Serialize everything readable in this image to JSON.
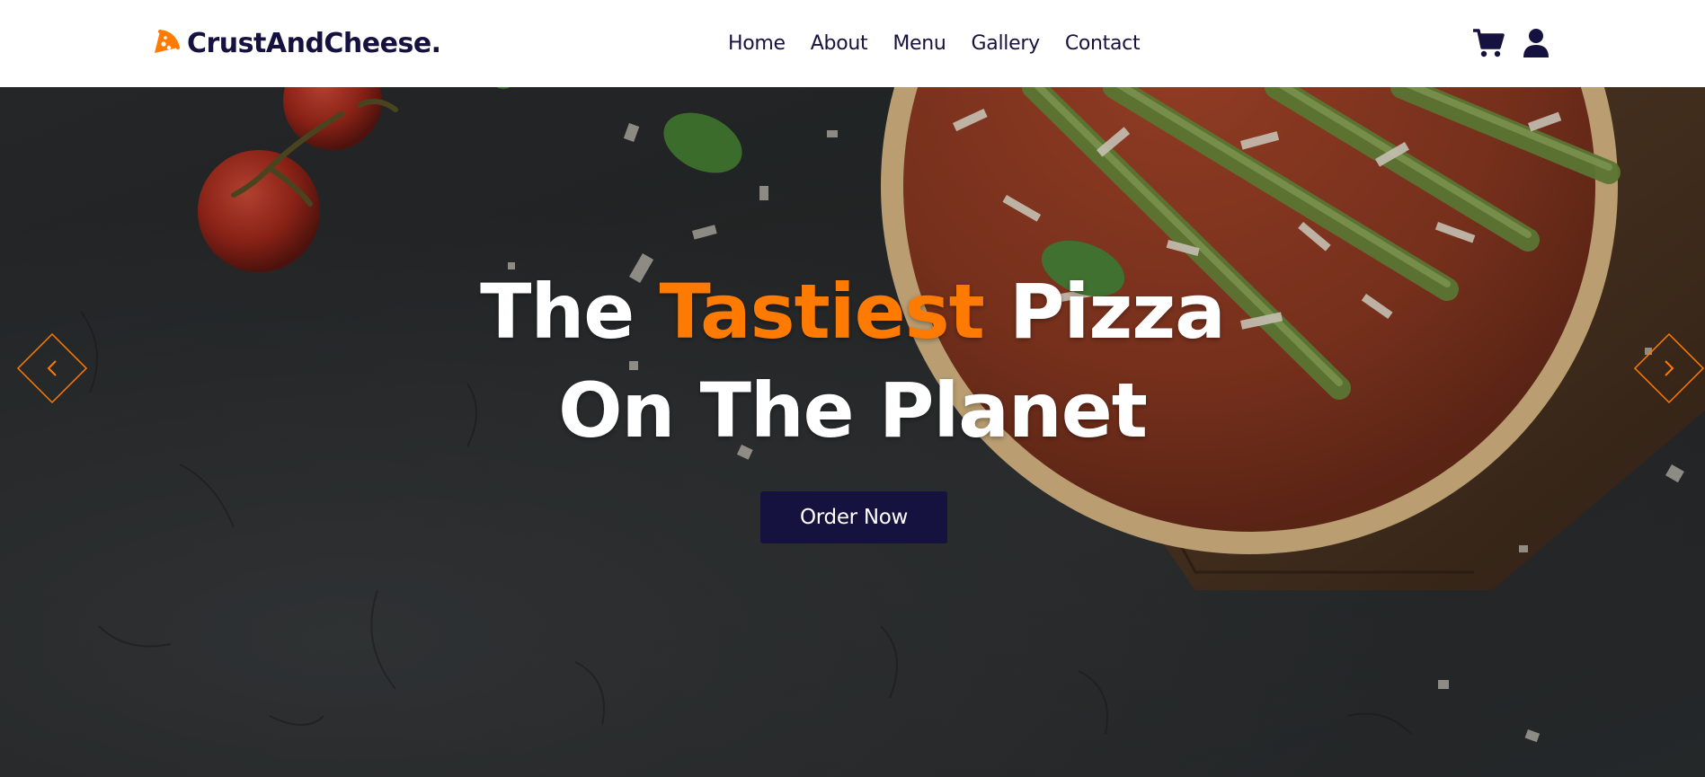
{
  "brand": {
    "name": "CrustAndCheese.",
    "icon": "pizza-slice-icon",
    "color": "#16123f"
  },
  "nav": {
    "links": [
      "Home",
      "About",
      "Menu",
      "Gallery",
      "Contact"
    ],
    "icons": [
      "cart-icon",
      "user-icon"
    ]
  },
  "hero": {
    "title_part1": "The",
    "title_highlight": "Tastiest",
    "title_part2": "Pizza",
    "title_line2": "On The Planet",
    "cta_label": "Order Now",
    "prev_icon": "chevron-left-icon",
    "next_icon": "chevron-right-icon"
  },
  "colors": {
    "accent": "#ff7a00",
    "primary": "#16123f",
    "background": "#ffffff"
  }
}
